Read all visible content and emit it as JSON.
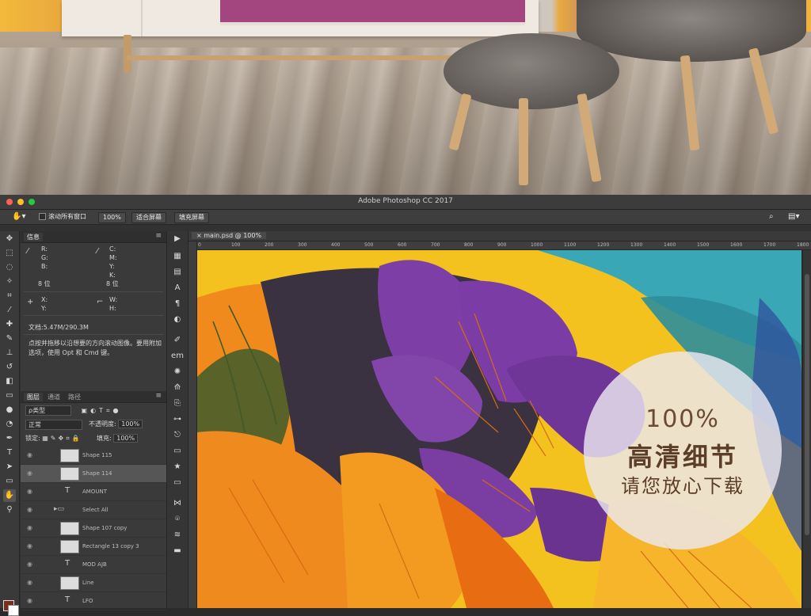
{
  "window": {
    "title": "Adobe Photoshop CC 2017",
    "traffic_lights": [
      "#fc5f57",
      "#fdbc2e",
      "#28c840"
    ]
  },
  "options_bar": {
    "scroll_all_windows": "滚动所有窗口",
    "zoom": "100%",
    "fit_screen": "适合屏幕",
    "fill_screen": "填充屏幕"
  },
  "info_panel": {
    "tab": "信息",
    "rgb_labels": [
      "R:",
      "G:",
      "B:"
    ],
    "cmyk_labels": [
      "C:",
      "M:",
      "Y:",
      "K:"
    ],
    "bit_left": "8 位",
    "bit_right": "8 位",
    "xy_labels": [
      "X:",
      "Y:"
    ],
    "wh_labels": [
      "W:",
      "H:"
    ],
    "doc_size": "文档:5.47M/290.3M",
    "hint": "点按并拖移以沿想要的方向滚动图像。要用附加选项，使用 Opt 和 Cmd 键。"
  },
  "layers_panel": {
    "tabs": [
      "图层",
      "通道",
      "路径"
    ],
    "filter_label": "ρ类型",
    "blend_mode": "正常",
    "opacity_label": "不透明度:",
    "opacity_value": "100%",
    "lock_label": "锁定:",
    "fill_label": "填充:",
    "fill_value": "100%",
    "layers": [
      {
        "name": "Shape 115",
        "kind": "shape"
      },
      {
        "name": "Shape 114",
        "kind": "shape"
      },
      {
        "name": "AMOUNT",
        "kind": "text"
      },
      {
        "name": "Select All",
        "kind": "group"
      },
      {
        "name": "Shape 107 copy",
        "kind": "shape"
      },
      {
        "name": "Rectangle 13 copy 3",
        "kind": "shape"
      },
      {
        "name": "MOD AJB",
        "kind": "text"
      },
      {
        "name": "Line",
        "kind": "shape"
      },
      {
        "name": "LFO",
        "kind": "text"
      }
    ]
  },
  "document": {
    "tab_title": "main.psd @ 100%",
    "ruler_ticks": [
      "0",
      "100",
      "200",
      "300",
      "400",
      "500",
      "600",
      "700",
      "800",
      "900",
      "1000",
      "1100",
      "1200",
      "1300",
      "1400",
      "1500",
      "1600",
      "1700",
      "1800"
    ]
  },
  "badge": {
    "line1": "100%",
    "line2": "高清细节",
    "line3": "请您放心下载"
  },
  "colors": {
    "foreground": "#7a2d1d",
    "background": "#ffffff",
    "canvas_yellow": "#f3c21f",
    "canvas_purple": "#7d3fa6",
    "canvas_dark": "#3a3240",
    "canvas_orange": "#f08a1c",
    "canvas_teal": "#3aa7b6"
  }
}
